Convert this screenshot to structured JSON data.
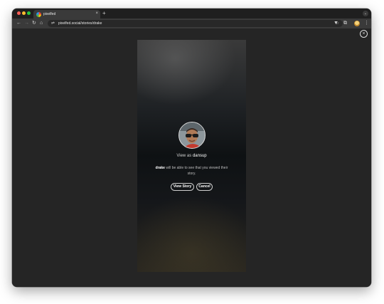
{
  "browser": {
    "tab": {
      "title": "pixelfed",
      "close_glyph": "×"
    },
    "new_tab_glyph": "+",
    "tab_menu_glyph": "⌄",
    "address_bar": {
      "url": "pixelfed.social/stories/drake"
    },
    "icons": {
      "back": "←",
      "forward": "→",
      "reload": "↻",
      "home": "⌂",
      "site_info": "⇌",
      "bookmark": "☆",
      "extensions": "▼",
      "puzzle": "⧉",
      "menu": "⋮"
    }
  },
  "page": {
    "close_glyph": "×",
    "story": {
      "view_as_prefix": "View as",
      "username": "dansup",
      "notice_owner": "drake",
      "notice_text": " will be able to see that you viewed their story.",
      "view_story_label": "View Story",
      "cancel_label": "Cancel"
    }
  }
}
